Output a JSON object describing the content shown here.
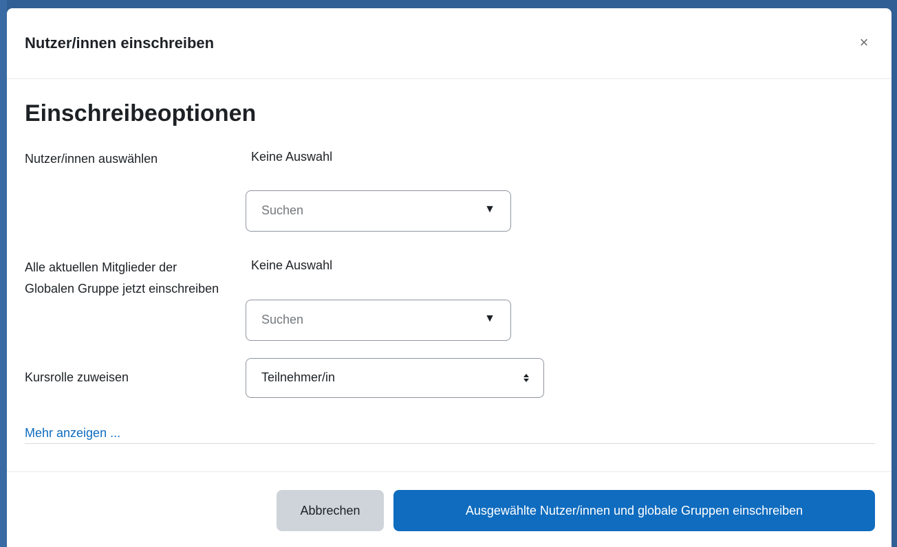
{
  "modal": {
    "title": "Nutzer/innen einschreiben",
    "close_symbol": "×"
  },
  "section": {
    "heading": "Einschreibeoptionen"
  },
  "fields": {
    "users": {
      "label": "Nutzer/innen auswählen",
      "selection": "Keine Auswahl",
      "placeholder": "Suchen",
      "arrow": "▼"
    },
    "cohorts": {
      "label": "Alle aktuellen Mitglieder der Globalen Gruppe jetzt einschreiben",
      "selection": "Keine Auswahl",
      "placeholder": "Suchen",
      "arrow": "▼"
    },
    "role": {
      "label": "Kursrolle zuweisen",
      "value": "Teilnehmer/in"
    }
  },
  "more_link": "Mehr anzeigen ...",
  "footer": {
    "cancel_label": "Abbrechen",
    "submit_label": "Ausgewählte Nutzer/innen und globale Gruppen einschreiben"
  },
  "colors": {
    "accent": "#0f6cbf",
    "secondary_button": "#ced4da",
    "backdrop": "#2f5f95"
  },
  "icons": {
    "close": "close-icon",
    "dropdown": "caret-down-icon",
    "select_updown": "updown-icon"
  }
}
